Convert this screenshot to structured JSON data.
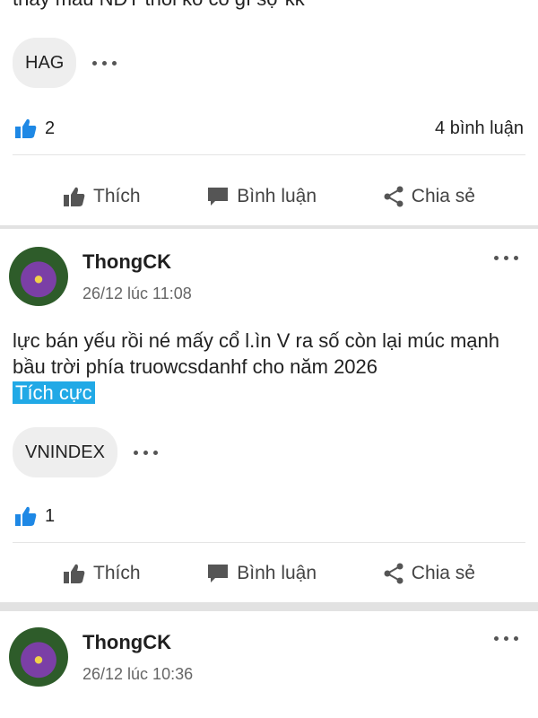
{
  "post0": {
    "clipped_text": "thay màu NĐT thôi kô có gì sợ kk",
    "tag": "HAG",
    "likes": "2",
    "comments": "4 bình luận"
  },
  "actions": {
    "like": "Thích",
    "comment": "Bình luận",
    "share": "Chia sẻ"
  },
  "post1": {
    "author": "ThongCK",
    "time": "26/12 lúc 11:08",
    "text": "lực bán yếu rồi né mấy cổ l.ìn V ra số còn lại múc mạnh bầu trời phía truowcsdanhf cho năm 2026",
    "sentiment": "Tích cực",
    "tag": "VNINDEX",
    "likes": "1"
  },
  "post2": {
    "author": "ThongCK",
    "time": "26/12 lúc 10:36"
  },
  "colors": {
    "accent": "#1e88e5",
    "sentiment_bg": "#21a9e6"
  },
  "icons": [
    "thumbs-up-icon",
    "comment-icon",
    "share-icon",
    "more-dots-icon"
  ]
}
